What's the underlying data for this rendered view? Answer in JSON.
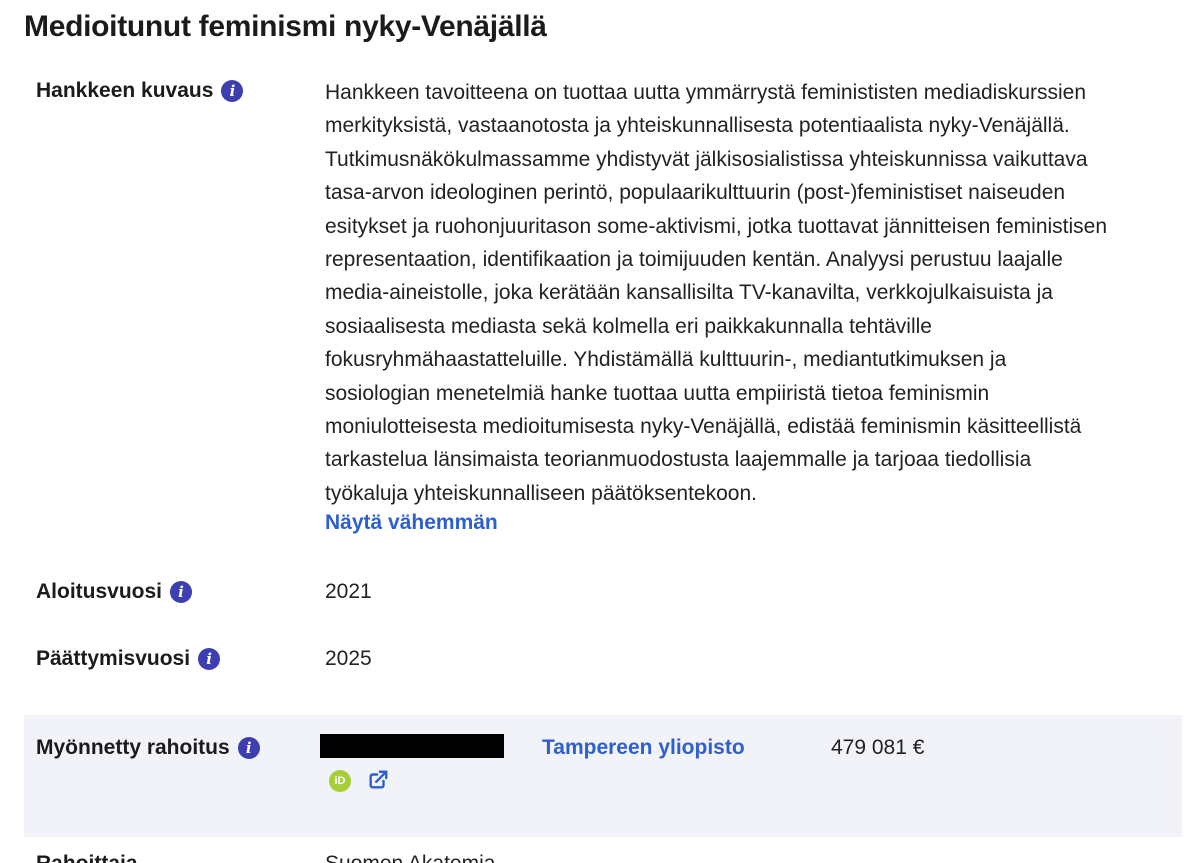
{
  "page": {
    "title": "Medioitunut feminismi nyky-Venäjällä"
  },
  "description": {
    "label": "Hankkeen kuvaus",
    "lines": [
      "Hankkeen tavoitteena on tuottaa uutta ymmärrystä feminististen mediadiskurssien",
      "merkityksistä, vastaanotosta ja yhteiskunnallisesta potentiaalista nyky-Venäjällä.",
      "Tutkimusnäkökulmassamme yhdistyvät jälkisosialistissa yhteiskunnissa vaikuttava",
      "tasa-arvon ideologinen perintö, populaarikulttuurin (post-)feministiset naiseuden",
      "esitykset ja ruohonjuuritason some-aktivismi, jotka tuottavat jännitteisen feministisen",
      "representaation, identifikaation ja toimijuuden kentän. Analyysi perustuu laajalle",
      "media-aineistolle, joka kerätään kansallisilta TV-kanavilta, verkkojulkaisuista ja",
      "sosiaalisesta mediasta sekä kolmella eri paikkakunnalla tehtäville",
      "fokusryhmähaastatteluille. Yhdistämällä kulttuurin-, mediantutkimuksen ja",
      "sosiologian menetelmiä hanke tuottaa uutta empiiristä tietoa feminismin",
      "moniulotteisesta medioitumisesta nyky-Venäjällä, edistää feminismin käsitteellistä",
      "tarkastelua länsimaista teorianmuodostusta laajemmalle ja tarjoaa tiedollisia",
      "työkaluja yhteiskunnalliseen päätöksentekoon."
    ],
    "toggle_label": "Näytä vähemmän"
  },
  "start_year": {
    "label": "Aloitusvuosi",
    "value": "2021"
  },
  "end_year": {
    "label": "Päättymisvuosi",
    "value": "2025"
  },
  "funding": {
    "label": "Myönnetty rahoitus",
    "organization": "Tampereen yliopisto",
    "amount": "479 081 €",
    "orcid_icon_text": "iD"
  },
  "cut_off_row": {
    "label": "Rahoittaja",
    "value": "Suomen Akatemia"
  },
  "icons": {
    "info": "info-icon",
    "orcid": "orcid-icon",
    "external": "external-link-icon"
  },
  "colors": {
    "link": "#2e5fcf",
    "info_icon": "#3d3fb0",
    "orcid": "#a6ce39",
    "funding_bg": "#f2f3f8"
  }
}
